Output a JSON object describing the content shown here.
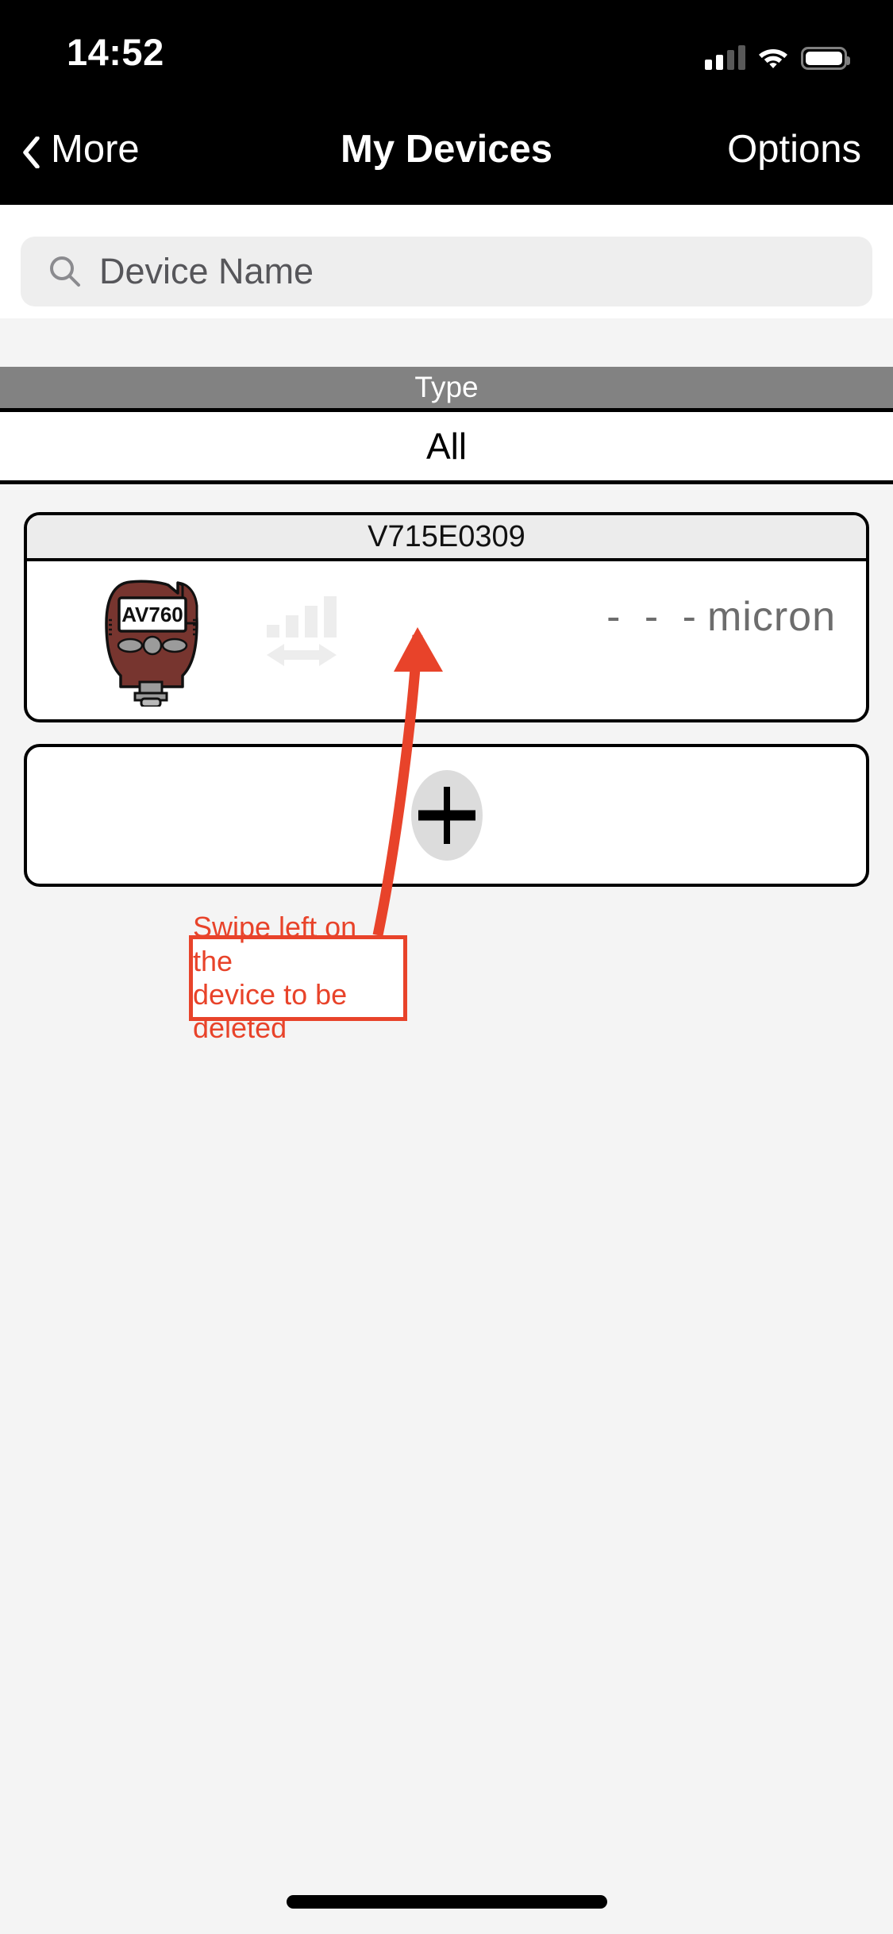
{
  "status_bar": {
    "time": "14:52",
    "signal_icon": "cellular-signal-icon",
    "signal_bars_filled": 2,
    "signal_bars_total": 4,
    "wifi_icon": "wifi-icon",
    "battery_icon": "battery-full-icon"
  },
  "nav_bar": {
    "back_icon": "chevron-left-icon",
    "back_label": "More",
    "title": "My Devices",
    "options_label": "Options"
  },
  "search": {
    "icon": "search-icon",
    "placeholder": "Device Name",
    "value": ""
  },
  "filter": {
    "header_label": "Type",
    "selected_value": "All"
  },
  "devices": [
    {
      "name": "V715E0309",
      "model_label": "AV760",
      "signal_icon": "signal-bars-icon",
      "sync_icon": "two-way-arrow-icon",
      "reading_dashes": "- - -",
      "reading_unit": "micron"
    }
  ],
  "add_device": {
    "icon": "plus-icon",
    "label": ""
  },
  "annotation": {
    "line1": "Swipe left on the",
    "line2": "device to be deleted",
    "color": "#e8432a",
    "arrow_icon": "arrow-up-annotation-icon"
  },
  "home_indicator": "home-indicator",
  "colors": {
    "nav_background": "#000000",
    "page_background": "#f4f4f4",
    "type_header": "#828282",
    "device_body": "#7b3838",
    "reading_text": "#6d6d6d",
    "annotation_red": "#e8432a"
  }
}
